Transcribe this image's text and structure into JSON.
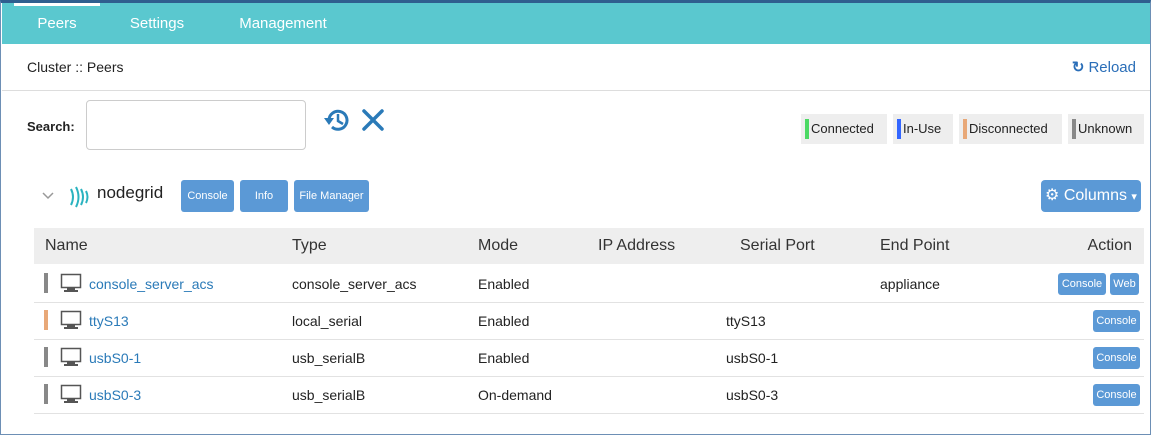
{
  "tabs": [
    {
      "label": "Peers",
      "active": true
    },
    {
      "label": "Settings",
      "active": false
    },
    {
      "label": "Management",
      "active": false
    }
  ],
  "breadcrumb": "Cluster :: Peers",
  "reload_label": "Reload",
  "search": {
    "label": "Search:",
    "value": "",
    "placeholder": ""
  },
  "legend": [
    {
      "label": "Connected",
      "color": "#4cd964"
    },
    {
      "label": "In-Use",
      "color": "#3366ff"
    },
    {
      "label": "Disconnected",
      "color": "#e8a878"
    },
    {
      "label": "Unknown",
      "color": "#888888"
    }
  ],
  "host": {
    "name": "nodegrid",
    "buttons": [
      "Console",
      "Info",
      "File Manager"
    ]
  },
  "columns_label": "Columns",
  "table": {
    "headers": [
      "Name",
      "Type",
      "Mode",
      "IP Address",
      "Serial Port",
      "End Point",
      "Action"
    ],
    "rows": [
      {
        "name": "console_server_acs",
        "type": "console_server_acs",
        "mode": "Enabled",
        "ip": "",
        "serial_port": "",
        "end_point": "appliance",
        "status_color": "#888888",
        "actions": [
          "Console",
          "Web"
        ]
      },
      {
        "name": "ttyS13",
        "type": "local_serial",
        "mode": "Enabled",
        "ip": "",
        "serial_port": "ttyS13",
        "end_point": "",
        "status_color": "#e8a878",
        "actions": [
          "Console"
        ]
      },
      {
        "name": "usbS0-1",
        "type": "usb_serialB",
        "mode": "Enabled",
        "ip": "",
        "serial_port": "usbS0-1",
        "end_point": "",
        "status_color": "#888888",
        "actions": [
          "Console"
        ]
      },
      {
        "name": "usbS0-3",
        "type": "usb_serialB",
        "mode": "On-demand",
        "ip": "",
        "serial_port": "usbS0-3",
        "end_point": "",
        "status_color": "#888888",
        "actions": [
          "Console"
        ]
      }
    ]
  }
}
